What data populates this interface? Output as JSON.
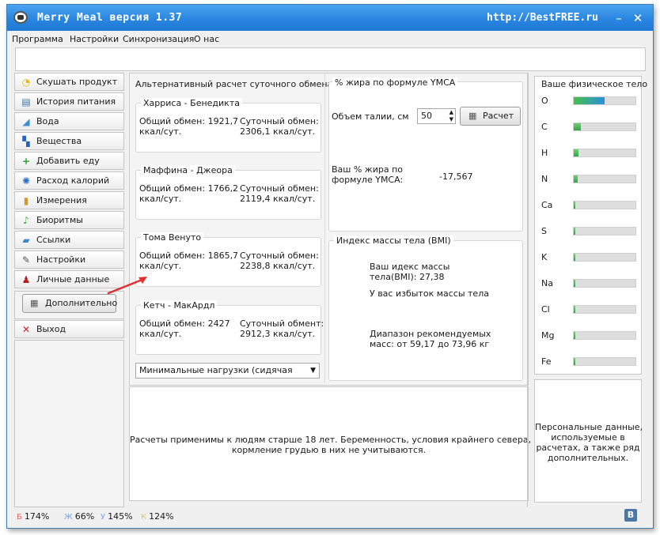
{
  "window": {
    "title": "Merry Meal версия 1.37",
    "watermark": "http://BestFREE.ru",
    "controls": {
      "minimize": "–",
      "close": "✕"
    }
  },
  "menu": [
    "Программа",
    "Настройки",
    "Синхронизация",
    "О нас"
  ],
  "sidebar": {
    "items": [
      {
        "label": "Скушать продукт",
        "icon": "pacman-icon",
        "glyph": "◔",
        "color": "#f0b400"
      },
      {
        "label": "История питания",
        "icon": "books-icon",
        "glyph": "▤",
        "color": "#3a6fb0"
      },
      {
        "label": "Вода",
        "icon": "water-icon",
        "glyph": "◢",
        "color": "#3a8fd8"
      },
      {
        "label": "Вещества",
        "icon": "flask-icon",
        "glyph": "▚",
        "color": "#2a62c0"
      },
      {
        "label": "Добавить еду",
        "icon": "plus-icon",
        "glyph": "+",
        "color": "#28a828"
      },
      {
        "label": "Расход калорий",
        "icon": "gear-icon",
        "glyph": "✺",
        "color": "#2a6fc8"
      },
      {
        "label": "Измерения",
        "icon": "ruler-icon",
        "glyph": "▮",
        "color": "#d09a30"
      },
      {
        "label": "Биоритмы",
        "icon": "music-note-icon",
        "glyph": "♪",
        "color": "#38a838"
      },
      {
        "label": "Ссылки",
        "icon": "book-icon",
        "glyph": "▰",
        "color": "#3a88d8"
      },
      {
        "label": "Настройки",
        "icon": "wrench-icon",
        "glyph": "✎",
        "color": "#555555"
      },
      {
        "label": "Личные данные",
        "icon": "person-icon",
        "glyph": "♟",
        "color": "#b02020"
      }
    ],
    "extra_button": "Дополнительно",
    "exit": {
      "label": "Выход",
      "glyph": "✕",
      "color": "#d02020"
    }
  },
  "metabolism": {
    "title": "Альтернативный расчет суточного обмена",
    "methods": [
      {
        "name": "Харриса - Бенедикта",
        "total_label": "Общий обмен: 1921,7",
        "total_unit": "ккал/сут.",
        "daily_label": "Суточный обмен:",
        "daily_value": "2306,1 ккал/сут."
      },
      {
        "name": "Маффина - Джеора",
        "total_label": "Общий обмен: 1766,2",
        "total_unit": "ккал/сут.",
        "daily_label": "Суточный обмен:",
        "daily_value": "2119,4 ккал/сут."
      },
      {
        "name": "Тома Венуто",
        "total_label": "Общий обмен: 1865,7",
        "total_unit": "ккал/сут.",
        "daily_label": "Суточный обмен:",
        "daily_value": "2238,8 ккал/сут."
      },
      {
        "name": "Кетч - МакАрдл",
        "total_label": "Общий обмен: 2427",
        "total_unit": "ккал/сут.",
        "daily_label": "Суточный обмент:",
        "daily_value": "2912,3 ккал/сут."
      }
    ],
    "activity_select": "Минимальные нагрузки (сидячая работа)"
  },
  "fat": {
    "title": "% жира по формуле YMCA",
    "waist_label": "Объем талии, см",
    "waist_value": "50",
    "calc_button": "Расчет",
    "result_label_1": "Ваш % жира по",
    "result_label_2": "формуле YMCA:",
    "result_value": "-17,567"
  },
  "bmi": {
    "title": "Индекс массы тела (BMI)",
    "line1": "Ваш идекс массы",
    "line2": "тела(BMI): 27,38",
    "status": "У вас избыток массы тела",
    "range1": "Диапазон рекомендуемых",
    "range2": "масс: от 59,17 до 73,96 кг"
  },
  "note": {
    "line1": "Расчеты применимы к людям старше 18 лет. Беременность, условия крайнего севера,",
    "line2": "кормление грудью в них не учитываются."
  },
  "body": {
    "title": "Ваше физическое тело",
    "elements": [
      {
        "label": "O",
        "fraction": 0.5
      },
      {
        "label": "C",
        "fraction": 0.12
      },
      {
        "label": "H",
        "fraction": 0.08
      },
      {
        "label": "N",
        "fraction": 0.06
      },
      {
        "label": "Ca",
        "fraction": 0.03
      },
      {
        "label": "S",
        "fraction": 0.03
      },
      {
        "label": "K",
        "fraction": 0.03
      },
      {
        "label": "Na",
        "fraction": 0.03
      },
      {
        "label": "Cl",
        "fraction": 0.03
      },
      {
        "label": "Mg",
        "fraction": 0.03
      },
      {
        "label": "Fe",
        "fraction": 0.03
      }
    ]
  },
  "personal_note": {
    "line1": "Персональные данные,",
    "line2": "используемые в",
    "line3": "расчетах, а также ряд",
    "line4": "дополнительных."
  },
  "status": [
    {
      "key": "Б",
      "value": "174%",
      "color": "#e06a6a"
    },
    {
      "key": "Ж",
      "value": "66%",
      "color": "#7aa8e0"
    },
    {
      "key": "У",
      "value": "145%",
      "color": "#7aa8e0"
    },
    {
      "key": "К",
      "value": "124%",
      "color": "#e0c860"
    }
  ],
  "vk": "B"
}
